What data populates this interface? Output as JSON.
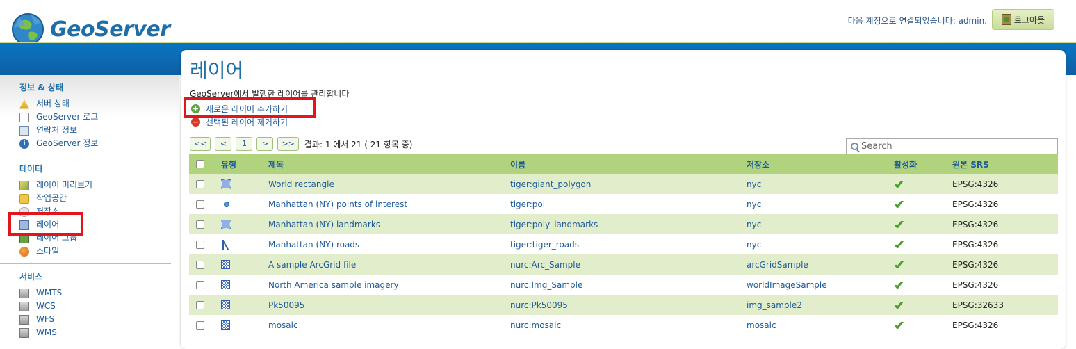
{
  "header": {
    "app_name": "GeoServer",
    "login_text": "다음 계정으로 연결되었습니다: admin.",
    "logout_label": "로그아웃"
  },
  "sidebar": {
    "sections": [
      {
        "title": "정보 & 상태",
        "items": [
          {
            "label": "서버 상태",
            "icon": "warning-icon"
          },
          {
            "label": "GeoServer 로그",
            "icon": "document-icon"
          },
          {
            "label": "연락처 정보",
            "icon": "contact-card-icon"
          },
          {
            "label": "GeoServer 정보",
            "icon": "info-icon"
          }
        ]
      },
      {
        "title": "데이터",
        "items": [
          {
            "label": "레이어 미리보기",
            "icon": "map-icon"
          },
          {
            "label": "작업공간",
            "icon": "folder-icon"
          },
          {
            "label": "저장소",
            "icon": "database-icon"
          },
          {
            "label": "레이어",
            "icon": "layer-icon"
          },
          {
            "label": "레이어 그룹",
            "icon": "layer-group-icon"
          },
          {
            "label": "스타일",
            "icon": "palette-icon"
          }
        ]
      },
      {
        "title": "서비스",
        "items": [
          {
            "label": "WMTS",
            "icon": "server-icon"
          },
          {
            "label": "WCS",
            "icon": "server-icon"
          },
          {
            "label": "WFS",
            "icon": "server-icon"
          },
          {
            "label": "WMS",
            "icon": "server-icon"
          }
        ]
      }
    ]
  },
  "main": {
    "title": "레이어",
    "description": "GeoServer에서 발행한 레이어를 관리합니다",
    "add_label": "새로운 레이어 추가하기",
    "remove_label": "선택된 레이어 제거하기",
    "pager": {
      "first": "<<",
      "prev": "<",
      "page": "1",
      "next": ">",
      "last": ">>",
      "summary": "결과: 1 에서 21 ( 21 항목 중)"
    },
    "search_placeholder": "Search",
    "table": {
      "columns": [
        "유형",
        "제목",
        "이름",
        "저장소",
        "활성화",
        "원본 SRS"
      ],
      "rows": [
        {
          "type": "polygon",
          "title": "World rectangle",
          "name": "tiger:giant_polygon",
          "store": "nyc",
          "enabled": true,
          "srs": "EPSG:4326"
        },
        {
          "type": "point",
          "title": "Manhattan (NY) points of interest",
          "name": "tiger:poi",
          "store": "nyc",
          "enabled": true,
          "srs": "EPSG:4326"
        },
        {
          "type": "polygon",
          "title": "Manhattan (NY) landmarks",
          "name": "tiger:poly_landmarks",
          "store": "nyc",
          "enabled": true,
          "srs": "EPSG:4326"
        },
        {
          "type": "line",
          "title": "Manhattan (NY) roads",
          "name": "tiger:tiger_roads",
          "store": "nyc",
          "enabled": true,
          "srs": "EPSG:4326"
        },
        {
          "type": "raster",
          "title": "A sample ArcGrid file",
          "name": "nurc:Arc_Sample",
          "store": "arcGridSample",
          "enabled": true,
          "srs": "EPSG:4326"
        },
        {
          "type": "raster",
          "title": "North America sample imagery",
          "name": "nurc:Img_Sample",
          "store": "worldImageSample",
          "enabled": true,
          "srs": "EPSG:4326"
        },
        {
          "type": "raster",
          "title": "Pk50095",
          "name": "nurc:Pk50095",
          "store": "img_sample2",
          "enabled": true,
          "srs": "EPSG:32633"
        },
        {
          "type": "raster",
          "title": "mosaic",
          "name": "nurc:mosaic",
          "store": "mosaic",
          "enabled": true,
          "srs": "EPSG:4326"
        }
      ]
    }
  }
}
